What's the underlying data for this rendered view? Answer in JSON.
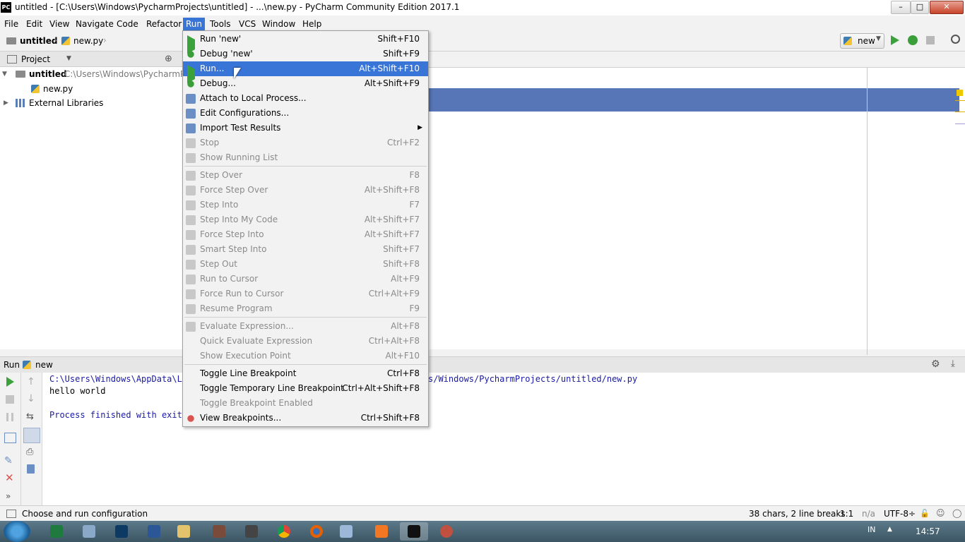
{
  "window": {
    "app_icon": "PC",
    "title": "untitled - [C:\\Users\\Windows\\PycharmProjects\\untitled] - ...\\new.py - PyCharm Community Edition 2017.1",
    "minimize": "–",
    "maximize": "□",
    "close": "✕"
  },
  "menubar": [
    "File",
    "Edit",
    "View",
    "Navigate",
    "Code",
    "Refactor",
    "Run",
    "Tools",
    "VCS",
    "Window",
    "Help"
  ],
  "navbar": {
    "project": "untitled",
    "file": "new.py",
    "run_config": "new"
  },
  "project_panel": {
    "header": "Project",
    "root_name": "untitled",
    "root_path": "C:\\Users\\Windows\\PycharmPro",
    "file": "new.py",
    "libs": "External Libraries"
  },
  "run_panel": {
    "label": "Run",
    "config": "new",
    "console": [
      "C:\\Users\\Windows\\AppData\\Lo",
      "hello world",
      "",
      "Process finished with exit"
    ],
    "console_tail": "s/Windows/PycharmProjects/untitled/new.py"
  },
  "status": {
    "message": "Choose and run configuration",
    "chars": "38 chars, 2 line breaks",
    "position": "1:1",
    "line_sep": "n/a",
    "encoding": "UTF-8÷"
  },
  "taskbar": {
    "lang": "IN",
    "time": "14:57"
  },
  "run_menu": [
    {
      "label": "Run 'new'",
      "shortcut": "Shift+F10",
      "icon": "play-icon",
      "disabled": false
    },
    {
      "label": "Debug 'new'",
      "shortcut": "Shift+F9",
      "icon": "bug-icon",
      "disabled": false
    },
    {
      "label": "Run...",
      "shortcut": "Alt+Shift+F10",
      "icon": "play-icon",
      "disabled": false,
      "highlight": true
    },
    {
      "label": "Debug...",
      "shortcut": "Alt+Shift+F9",
      "icon": "bug-icon",
      "disabled": false
    },
    {
      "label": "Attach to Local Process...",
      "shortcut": "",
      "icon": "attach-icon",
      "disabled": false
    },
    {
      "label": "Edit Configurations...",
      "shortcut": "",
      "icon": "edit-config-icon",
      "disabled": false
    },
    {
      "label": "Import Test Results",
      "shortcut": "",
      "icon": "import-icon",
      "disabled": false,
      "submenu": true
    },
    {
      "label": "Stop",
      "shortcut": "Ctrl+F2",
      "icon": "stop-icon",
      "disabled": true
    },
    {
      "label": "Show Running List",
      "shortcut": "",
      "icon": "list-icon",
      "disabled": true,
      "sep_after": true
    },
    {
      "label": "Step Over",
      "shortcut": "F8",
      "icon": "step-over-icon",
      "disabled": true
    },
    {
      "label": "Force Step Over",
      "shortcut": "Alt+Shift+F8",
      "icon": "force-step-over-icon",
      "disabled": true
    },
    {
      "label": "Step Into",
      "shortcut": "F7",
      "icon": "step-into-icon",
      "disabled": true
    },
    {
      "label": "Step Into My Code",
      "shortcut": "Alt+Shift+F7",
      "icon": "step-into-my-code-icon",
      "disabled": true
    },
    {
      "label": "Force Step Into",
      "shortcut": "Alt+Shift+F7",
      "icon": "force-step-into-icon",
      "disabled": true
    },
    {
      "label": "Smart Step Into",
      "shortcut": "Shift+F7",
      "icon": "smart-step-into-icon",
      "disabled": true
    },
    {
      "label": "Step Out",
      "shortcut": "Shift+F8",
      "icon": "step-out-icon",
      "disabled": true
    },
    {
      "label": "Run to Cursor",
      "shortcut": "Alt+F9",
      "icon": "run-to-cursor-icon",
      "disabled": true
    },
    {
      "label": "Force Run to Cursor",
      "shortcut": "Ctrl+Alt+F9",
      "icon": "force-run-to-cursor-icon",
      "disabled": true
    },
    {
      "label": "Resume Program",
      "shortcut": "F9",
      "icon": "resume-icon",
      "disabled": true,
      "sep_after": true
    },
    {
      "label": "Evaluate Expression...",
      "shortcut": "Alt+F8",
      "icon": "evaluate-icon",
      "disabled": true
    },
    {
      "label": "Quick Evaluate Expression",
      "shortcut": "Ctrl+Alt+F8",
      "icon": "",
      "disabled": true
    },
    {
      "label": "Show Execution Point",
      "shortcut": "Alt+F10",
      "icon": "",
      "disabled": true,
      "sep_after": true
    },
    {
      "label": "Toggle Line Breakpoint",
      "shortcut": "Ctrl+F8",
      "icon": "",
      "disabled": false
    },
    {
      "label": "Toggle Temporary Line Breakpoint",
      "shortcut": "Ctrl+Alt+Shift+F8",
      "icon": "",
      "disabled": false
    },
    {
      "label": "Toggle Breakpoint Enabled",
      "shortcut": "",
      "icon": "",
      "disabled": true
    },
    {
      "label": "View Breakpoints...",
      "shortcut": "Ctrl+Shift+F8",
      "icon": "breakpoints-icon",
      "disabled": false
    }
  ]
}
